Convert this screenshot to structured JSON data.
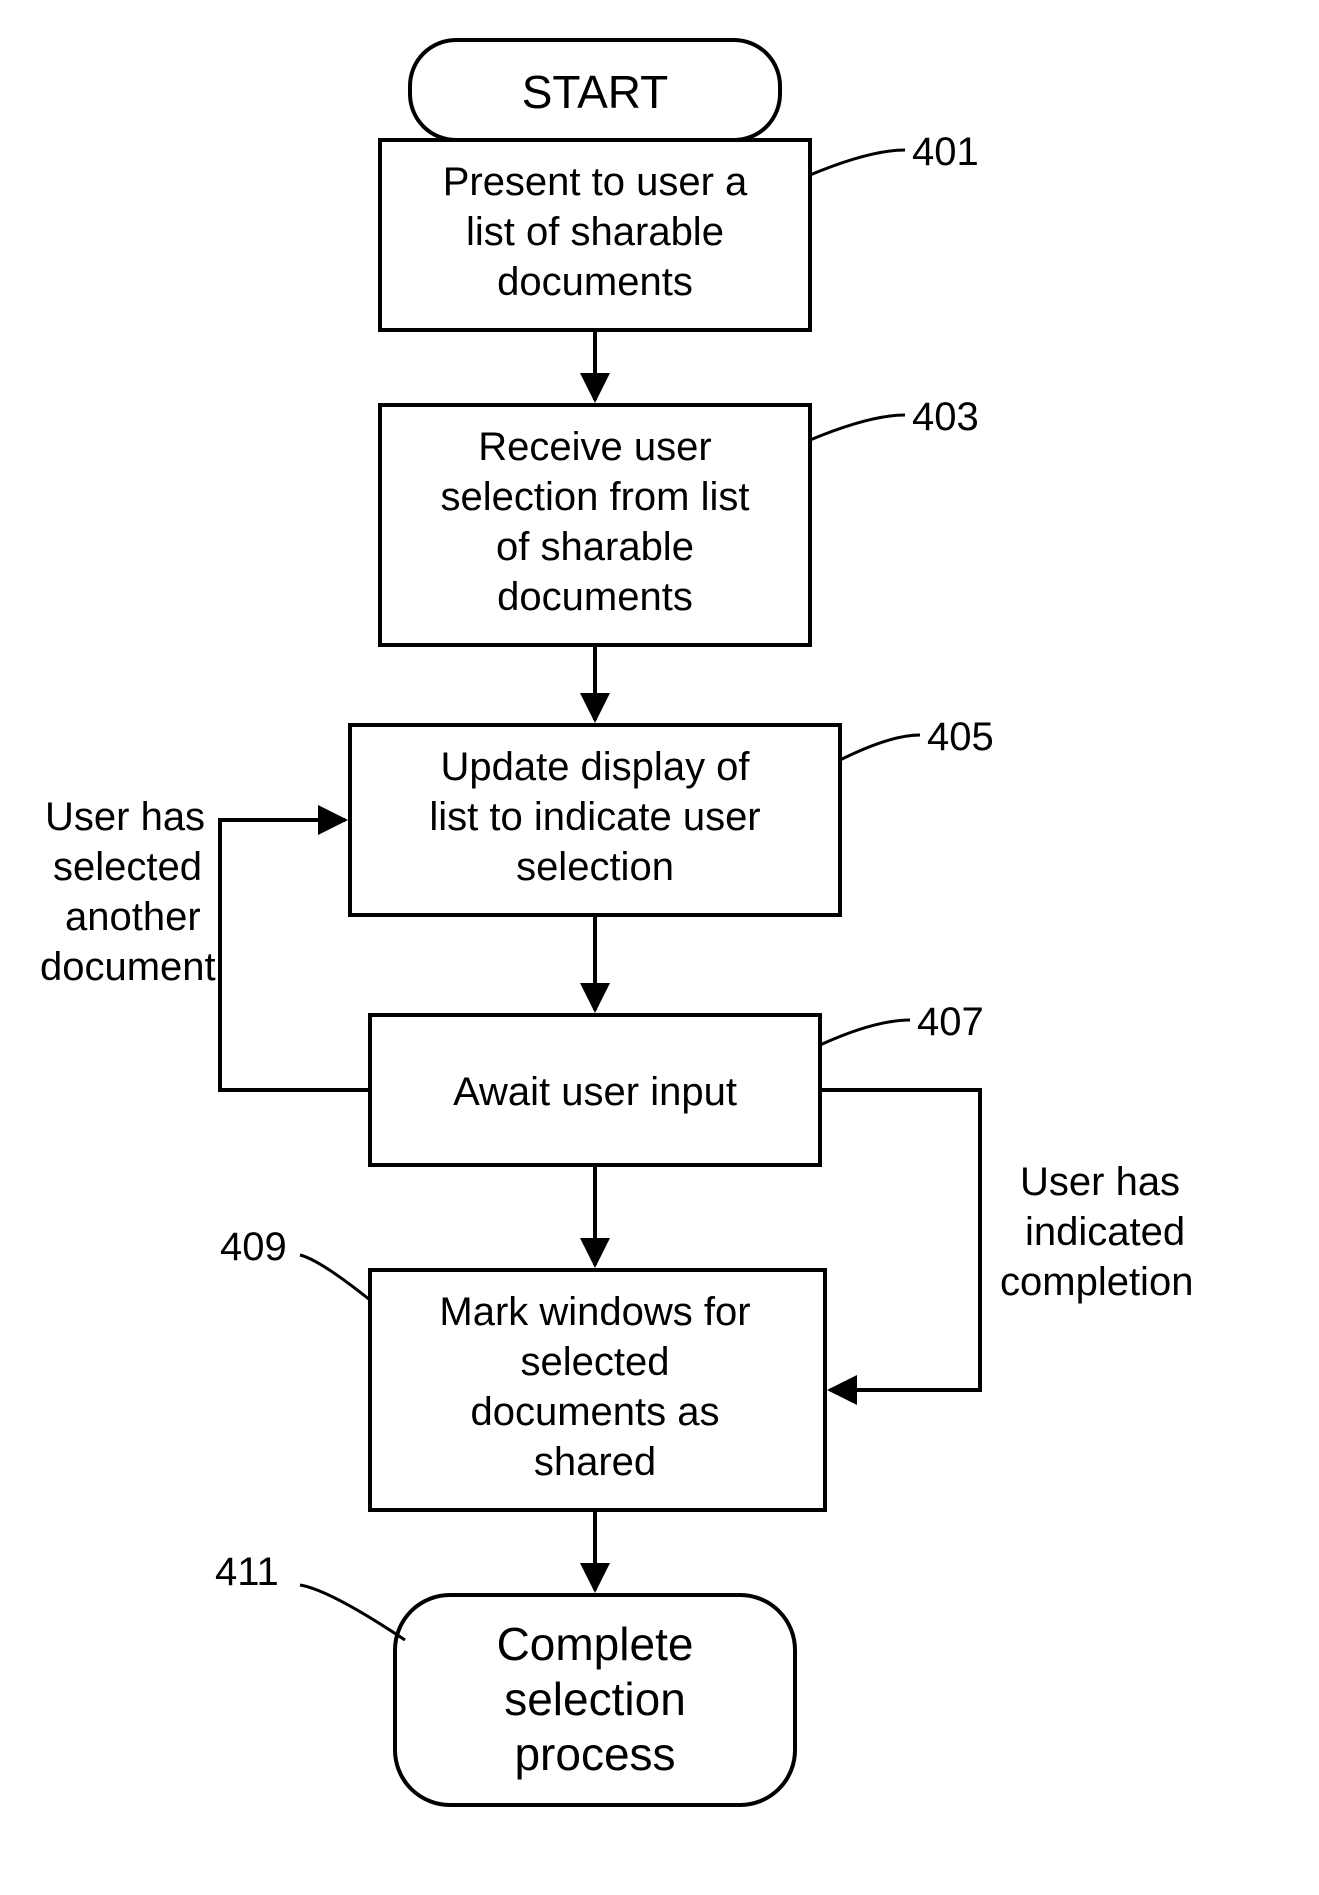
{
  "nodes": {
    "start": "START",
    "n401": {
      "ref": "401",
      "lines": [
        "Present to user a",
        "list of sharable",
        "documents"
      ]
    },
    "n403": {
      "ref": "403",
      "lines": [
        "Receive user",
        "selection from list",
        "of sharable",
        "documents"
      ]
    },
    "n405": {
      "ref": "405",
      "lines": [
        "Update display of",
        "list to indicate user",
        "selection"
      ]
    },
    "n407": {
      "ref": "407",
      "lines": [
        "Await user input"
      ]
    },
    "n409": {
      "ref": "409",
      "lines": [
        "Mark windows for",
        "selected",
        "documents as",
        "shared"
      ]
    },
    "n411": {
      "ref": "411",
      "lines": [
        "Complete",
        "selection",
        "process"
      ]
    }
  },
  "edges": {
    "loop": [
      "User has",
      "selected",
      "another",
      "document"
    ],
    "complete": [
      "User has",
      "indicated",
      "completion"
    ]
  }
}
